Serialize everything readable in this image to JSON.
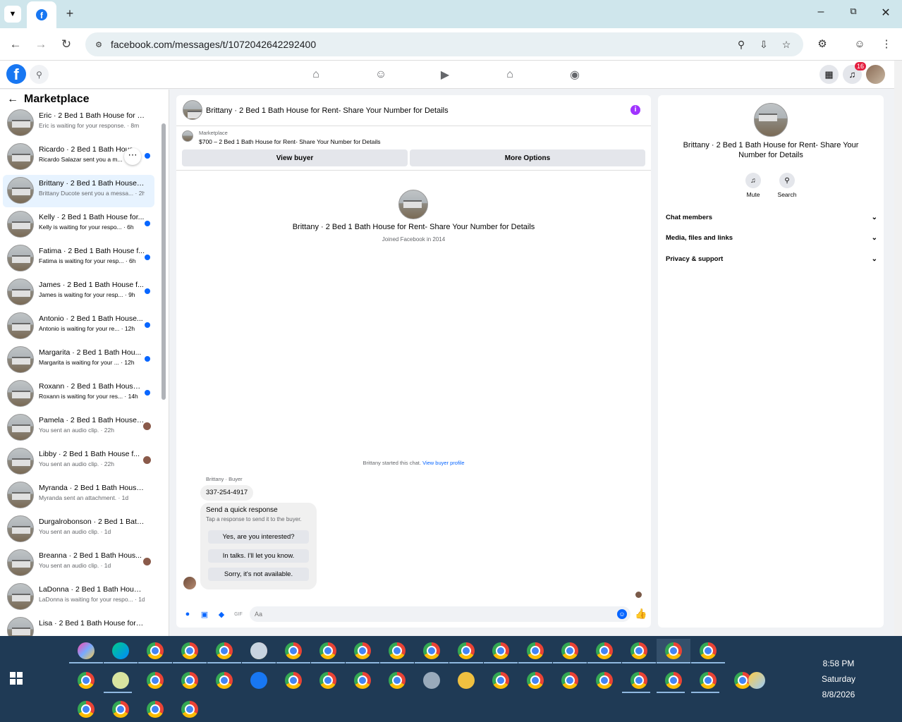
{
  "browser": {
    "url": "facebook.com/messages/t/1072042642292400"
  },
  "fb": {
    "notifications_count": "16"
  },
  "left_panel": {
    "title": "Marketplace",
    "conversations": [
      {
        "title": "Eric · 2 Bed 1 Bath House for Re...",
        "subtitle": "Eric is waiting for your response. · 8m",
        "indicator": "none"
      },
      {
        "title": "Ricardo · 2 Bed 1 Bath Hous",
        "subtitle": "Ricardo Salazar sent you a m...",
        "indicator": "dot"
      },
      {
        "title": "Brittany · 2 Bed 1 Bath House f...",
        "subtitle": "Brittany Ducote sent you a messa... · 2h",
        "indicator": "none"
      },
      {
        "title": "Kelly · 2 Bed 1 Bath House for...",
        "subtitle": "Kelly is waiting for your respo... · 6h",
        "indicator": "dot"
      },
      {
        "title": "Fatima · 2 Bed 1 Bath House f...",
        "subtitle": "Fatima is waiting for your resp... · 6h",
        "indicator": "dot"
      },
      {
        "title": "James · 2 Bed 1 Bath House f...",
        "subtitle": "James is waiting for your resp... · 9h",
        "indicator": "dot"
      },
      {
        "title": "Antonio · 2 Bed 1 Bath House...",
        "subtitle": "Antonio is waiting for your re... · 12h",
        "indicator": "dot"
      },
      {
        "title": "Margarita · 2 Bed 1 Bath Hou...",
        "subtitle": "Margarita is waiting for your ... · 12h",
        "indicator": "dot"
      },
      {
        "title": "Roxann · 2 Bed 1 Bath House ...",
        "subtitle": "Roxann is waiting for your res... · 14h",
        "indicator": "dot"
      },
      {
        "title": "Pamela · 2 Bed 1 Bath House ...",
        "subtitle": "You sent an audio clip. · 22h",
        "indicator": "avatar"
      },
      {
        "title": "Libby · 2 Bed 1 Bath House f...",
        "subtitle": "You sent an audio clip. · 22h",
        "indicator": "avatar"
      },
      {
        "title": "Myranda · 2 Bed 1 Bath House f...",
        "subtitle": "Myranda sent an attachment. · 1d",
        "indicator": "none"
      },
      {
        "title": "Durgalrobonson · 2 Bed 1 Bath ...",
        "subtitle": "You sent an audio clip. · 1d",
        "indicator": "none"
      },
      {
        "title": "Breanna · 2 Bed 1 Bath Hous...",
        "subtitle": "You sent an audio clip. · 1d",
        "indicator": "avatar"
      },
      {
        "title": "LaDonna · 2 Bed 1 Bath House f...",
        "subtitle": "LaDonna is waiting for your respo... · 1d",
        "indicator": "none"
      },
      {
        "title": "Lisa · 2 Bed 1 Bath House for R...",
        "subtitle": "",
        "indicator": "none"
      }
    ]
  },
  "chat": {
    "title": "Brittany · 2 Bed 1 Bath House for Rent- Share Your Number for Details",
    "marketplace_label": "Marketplace",
    "marketplace_item": "$700 – 2 Bed 1 Bath House for Rent- Share Your Number for Details",
    "view_buyer": "View buyer",
    "more_options": "More Options",
    "intro_name": "Brittany · 2 Bed 1 Bath House for Rent- Share Your Number for Details",
    "joined": "Joined Facebook in 2014",
    "started_text": "Brittany started this chat.",
    "view_buyer_profile": "View buyer profile",
    "sender_label": "Brittany · Buyer",
    "phone_message": "337-254-4917",
    "quick_title": "Send a quick response",
    "quick_sub": "Tap a response to send it to the buyer.",
    "quick_replies": [
      "Yes, are you interested?",
      "In talks. I'll let you know.",
      "Sorry, it's not available."
    ],
    "composer_placeholder": "Aa"
  },
  "right_panel": {
    "name": "Brittany · 2 Bed 1 Bath House for Rent- Share Your Number for Details",
    "mute": "Mute",
    "search": "Search",
    "sections": [
      "Chat members",
      "Media, files and links",
      "Privacy & support"
    ]
  },
  "taskbar": {
    "time": "8:58 PM",
    "day": "Saturday",
    "date": "8/8/2026"
  }
}
